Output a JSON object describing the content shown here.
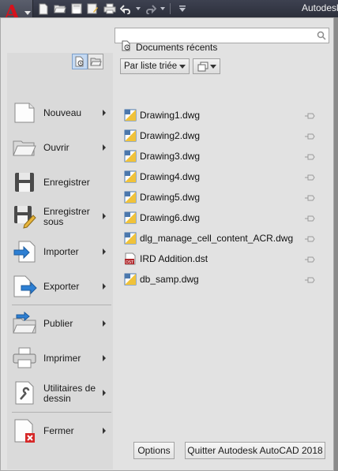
{
  "titlebar": {
    "title": "Autodesk",
    "app_button_icon": "autocad-logo-icon",
    "quick_access": [
      "new-file-icon",
      "open-file-icon",
      "save-icon",
      "save-as-icon",
      "plot-icon",
      "undo-icon",
      "redo-icon",
      "customize-dropdown-icon"
    ]
  },
  "search": {
    "placeholder": "",
    "value": ""
  },
  "left_menu": {
    "view_toggle": [
      "recent-documents-icon",
      "open-documents-icon"
    ],
    "items": [
      {
        "label": "Nouveau",
        "icon": "new-document-icon",
        "submenu": true
      },
      {
        "label": "Ouvrir",
        "icon": "open-folder-icon",
        "submenu": true
      },
      {
        "label": "Enregistrer",
        "icon": "save-disk-icon",
        "submenu": false
      },
      {
        "label": "Enregistrer sous",
        "icon": "save-as-disk-icon",
        "submenu": true
      },
      {
        "label": "Importer",
        "icon": "import-icon",
        "submenu": true
      },
      {
        "label": "Exporter",
        "icon": "export-icon",
        "submenu": true
      },
      {
        "label": "Publier",
        "icon": "publish-icon",
        "submenu": true
      },
      {
        "label": "Imprimer",
        "icon": "printer-icon",
        "submenu": true
      },
      {
        "label": "Utilitaires de dessin",
        "icon": "drawing-utilities-icon",
        "submenu": true
      },
      {
        "label": "Fermer",
        "icon": "close-document-icon",
        "submenu": true
      }
    ]
  },
  "recent": {
    "title": "Documents récents",
    "sort_label": "Par liste triée",
    "files": [
      {
        "name": "Drawing1.dwg",
        "type": "dwg"
      },
      {
        "name": "Drawing2.dwg",
        "type": "dwg"
      },
      {
        "name": "Drawing3.dwg",
        "type": "dwg"
      },
      {
        "name": "Drawing4.dwg",
        "type": "dwg"
      },
      {
        "name": "Drawing5.dwg",
        "type": "dwg"
      },
      {
        "name": "Drawing6.dwg",
        "type": "dwg"
      },
      {
        "name": "dlg_manage_cell_content_ACR.dwg",
        "type": "dwg"
      },
      {
        "name": "IRD Addition.dst",
        "type": "dst"
      },
      {
        "name": "db_samp.dwg",
        "type": "dwg"
      }
    ]
  },
  "buttons": {
    "options": "Options",
    "quit": "Quitter Autodesk AutoCAD 2018"
  },
  "colors": {
    "accent_red": "#d6121c",
    "titlebar": "#2f3240",
    "menu_bg": "#e2e2e2",
    "dst_badge": "#b0262a"
  }
}
